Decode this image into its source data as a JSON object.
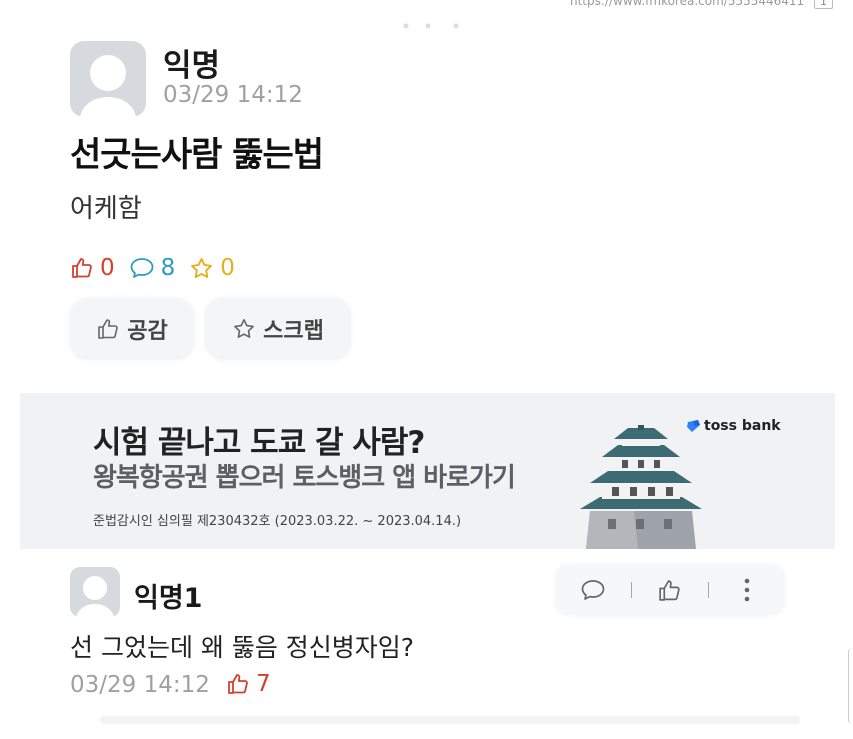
{
  "browser": {
    "url": "https://www.fmkorea.com/5555446411",
    "tab_indicator": "1"
  },
  "post": {
    "author": "익명",
    "timestamp": "03/29 14:12",
    "title": "선긋는사람 뚫는법",
    "body": "어케함",
    "stats": {
      "likes": "0",
      "comments": "8",
      "scraps": "0"
    },
    "like_button_label": "공감",
    "scrap_button_label": "스크랩"
  },
  "ad": {
    "headline": "시험 끝나고 도쿄 갈 사람?",
    "subline": "왕복항공권 뽑으러 토스뱅크 앱 바로가기",
    "notice": "준법감시인 심의필 제230432호 (2023.03.22. ~ 2023.04.14.)",
    "brand": "toss bank",
    "brand_color": "#3182f6"
  },
  "comment": {
    "author": "익명1",
    "body": "선 그었는데 왜 뚫음 정신병자임?",
    "timestamp": "03/29 14:12",
    "likes": "7"
  },
  "colors": {
    "like": "#d2412e",
    "comment": "#2e9cc0",
    "scrap": "#e3b11b",
    "muted_text": "#a0a0a0"
  }
}
